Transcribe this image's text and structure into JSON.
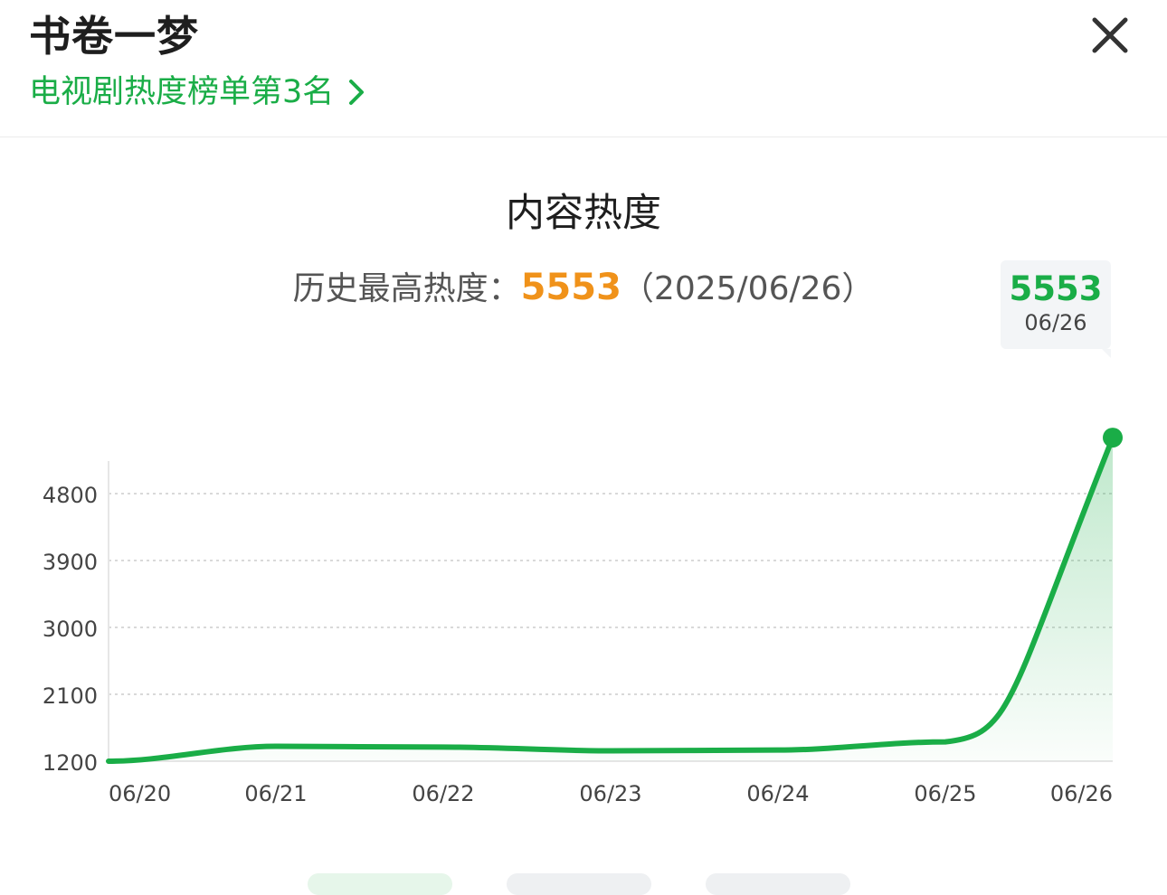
{
  "header": {
    "title": "书卷一梦",
    "rank_text": "电视剧热度榜单第3名"
  },
  "summary": {
    "chart_title": "内容热度",
    "peak_label": "历史最高热度：",
    "peak_value": "5553",
    "peak_date": "（2025/06/26）"
  },
  "tooltip": {
    "value": "5553",
    "date": "06/26"
  },
  "colors": {
    "accent": "#1aad47",
    "peak": "#f0921a"
  },
  "icons": {
    "close": "close-icon",
    "chevron": "chevron-right-icon"
  },
  "chart_data": {
    "type": "area",
    "x": [
      "06/20",
      "06/21",
      "06/22",
      "06/23",
      "06/24",
      "06/25",
      "06/26"
    ],
    "series": [
      {
        "values": [
          1200,
          1400,
          1390,
          1340,
          1350,
          1460,
          5553
        ]
      }
    ],
    "yticks": [
      1200,
      2100,
      3000,
      3900,
      4800
    ],
    "ylim": [
      1200,
      5553
    ],
    "grid": true,
    "highlight_point": {
      "x": "06/26",
      "y": 5553
    }
  }
}
